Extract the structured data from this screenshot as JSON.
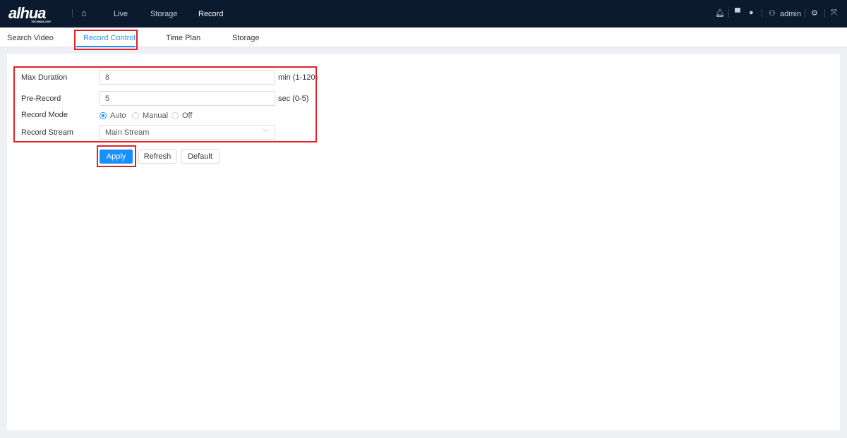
{
  "header": {
    "logo": "alhua",
    "logo_sub": "TECHNOLOGY",
    "nav": [
      "Live",
      "Storage",
      "Record"
    ],
    "user": "admin",
    "icons": [
      "home-icon",
      "bell-icon",
      "shirt-icon",
      "globe-icon",
      "user-icon",
      "gear-icon",
      "fullscreen-icon"
    ]
  },
  "tabs": [
    "Search Video",
    "Record Control",
    "Time Plan",
    "Storage"
  ],
  "form": {
    "max_duration": {
      "label": "Max Duration",
      "value": "8",
      "unit": "min (1-120)"
    },
    "pre_record": {
      "label": "Pre-Record",
      "value": "5",
      "unit": "sec (0-5)"
    },
    "record_mode": {
      "label": "Record Mode",
      "options": [
        "Auto",
        "Manual",
        "Off"
      ],
      "selected": "Auto"
    },
    "record_stream": {
      "label": "Record Stream",
      "value": "Main Stream"
    }
  },
  "buttons": {
    "apply": "Apply",
    "refresh": "Refresh",
    "default": "Default"
  },
  "colors": {
    "accent": "#1890ff",
    "header": "#0c1a2f",
    "highlight": "#e0202a"
  }
}
